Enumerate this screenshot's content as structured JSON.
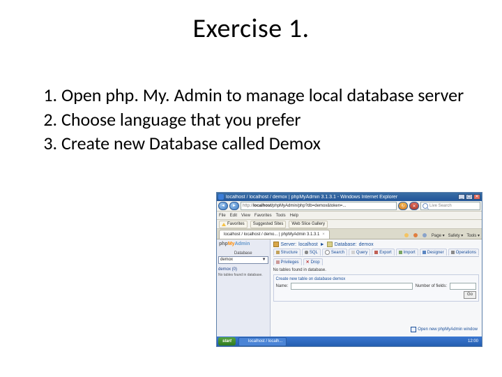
{
  "slide": {
    "title": "Exercise 1.",
    "items": [
      "Open php. My. Admin to manage local database server",
      "Choose language that you prefer",
      "Create new Database called Demox"
    ]
  },
  "browser": {
    "window_title": "localhost / localhost / demox | phpMyAdmin 3.1.3.1 - Windows Internet Explorer",
    "min": "_",
    "max": "▢",
    "close": "✕",
    "back": "◄",
    "fwd": "►",
    "url_proto": "http://",
    "url_host": "localhost",
    "url_rest": "/phpMyAdmin/php?db=demox&token=...",
    "search_placeholder": "Live Search",
    "menu": [
      "File",
      "Edit",
      "View",
      "Favorites",
      "Tools",
      "Help"
    ],
    "fav_label": "Favorites",
    "fav_item": "Suggested Sites",
    "fav_item2": "Web Slice Gallery",
    "tab_label": "localhost / localhost / demo... | phpMyAdmin 3.1.3.1",
    "tab_close": "×",
    "page_tools": [
      "Page ▾",
      "Safety ▾",
      "Tools ▾"
    ]
  },
  "pma": {
    "logo_php": "php",
    "logo_my": "My",
    "logo_admin": "Admin",
    "sb_label": "Database",
    "sb_selected": "demox",
    "sb_entry": "demox (0)",
    "sb_note": "No tables found in database.",
    "bc_server_label": "Server:",
    "bc_server_value": "localhost",
    "bc_sep": "►",
    "bc_db_label": "Database:",
    "bc_db_value": "demox",
    "tabs": [
      "Structure",
      "SQL",
      "Search",
      "Query",
      "Export",
      "Import",
      "Designer",
      "Operations"
    ],
    "tabs2": [
      "Privileges",
      "Drop"
    ],
    "msg": "No tables found in database.",
    "legend": "Create new table on database demox",
    "lbl_name": "Name:",
    "lbl_fields": "Number of fields:",
    "go": "Go",
    "open_new": "Open new phpMyAdmin window"
  },
  "taskbar": {
    "start": "start",
    "task": "localhost / localh...",
    "clock": "12:00"
  }
}
